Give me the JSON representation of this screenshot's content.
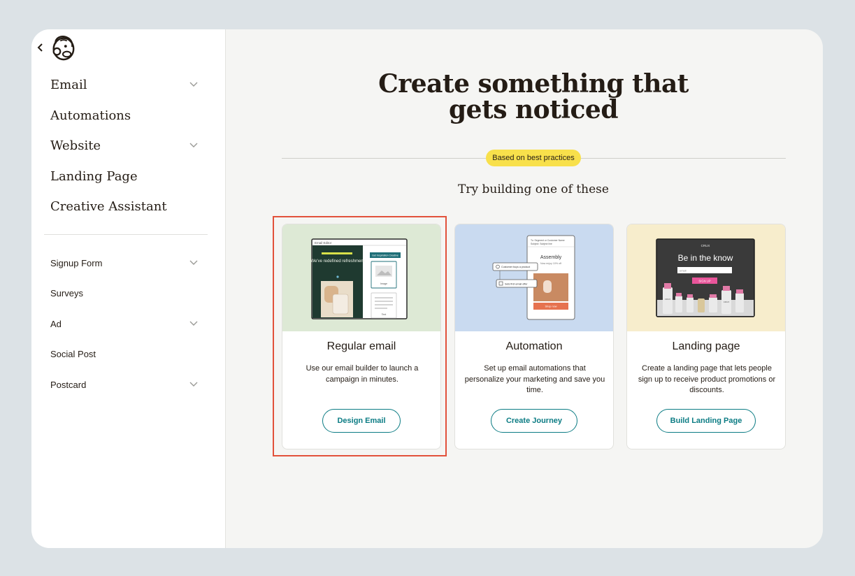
{
  "sidebar": {
    "primary_items": [
      {
        "label": "Email",
        "has_chevron": true
      },
      {
        "label": "Automations",
        "has_chevron": false
      },
      {
        "label": "Website",
        "has_chevron": true
      },
      {
        "label": "Landing Page",
        "has_chevron": false
      },
      {
        "label": "Creative Assistant",
        "has_chevron": false
      }
    ],
    "secondary_items": [
      {
        "label": "Signup Form",
        "has_chevron": true
      },
      {
        "label": "Surveys",
        "has_chevron": false
      },
      {
        "label": "Ad",
        "has_chevron": true
      },
      {
        "label": "Social Post",
        "has_chevron": false
      },
      {
        "label": "Postcard",
        "has_chevron": true
      }
    ]
  },
  "main": {
    "title_lines": [
      "Create something that",
      "gets noticed"
    ],
    "badge": "Based on best practices",
    "subtitle": "Try building one of these",
    "cards": [
      {
        "title": "Regular email",
        "description": "Use our email builder to launch a campaign in minutes.",
        "button": "Design Email",
        "hero_color": "#dde9d5",
        "highlighted": true,
        "preview": {
          "editor_label": "Email Editor",
          "headline": "We've redefined refreshment",
          "side_button": "Get Inspiration Creative",
          "image_label": "Image",
          "text_label": "Text"
        }
      },
      {
        "title": "Automation",
        "description": "Set up email automations that personalize your marketing and save you time.",
        "button": "Create Journey",
        "hero_color": "#c9daf0",
        "highlighted": false,
        "preview": {
          "to_line": "To: Segment or Customer Name",
          "subject_line": "Subject: Subject line",
          "brand": "Assembly",
          "offer": "Now enjoy 10% off",
          "trigger": "Customer buys a product",
          "action": "Sets first email offer",
          "cta": "Shop now"
        }
      },
      {
        "title": "Landing page",
        "description": "Create a landing page that lets people sign up to receive product promotions or discounts.",
        "button": "Build Landing Page",
        "hero_color": "#f7edcc",
        "highlighted": false,
        "preview": {
          "brand": "CRUX",
          "headline": "Be in the know",
          "field_placeholder": "email",
          "cta": "SIGN UP",
          "bottle_label": "CRUX"
        }
      }
    ]
  },
  "colors": {
    "accent": "#0c7c84",
    "badge": "#f8e04b",
    "highlight_border": "#e2513b",
    "text": "#241c15"
  }
}
